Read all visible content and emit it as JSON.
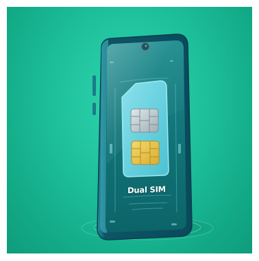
{
  "image": {
    "kind": "illustration",
    "subject": "smartphone-with-dual-sim-card",
    "caption": "Dual SIM"
  },
  "colors": {
    "background": "#1dbf9a",
    "phone_body": "#0e5a6b",
    "screen": "#0f6e74",
    "sim_card": "#6fd8e6",
    "chip_silver": "#b9c6cc",
    "chip_gold": "#e8c44e",
    "caption_text": "#ffffff"
  },
  "icons": [
    "phone-illustration",
    "sim-card-icon",
    "sim-chip-silver-icon",
    "sim-chip-gold-icon",
    "front-camera-icon"
  ]
}
